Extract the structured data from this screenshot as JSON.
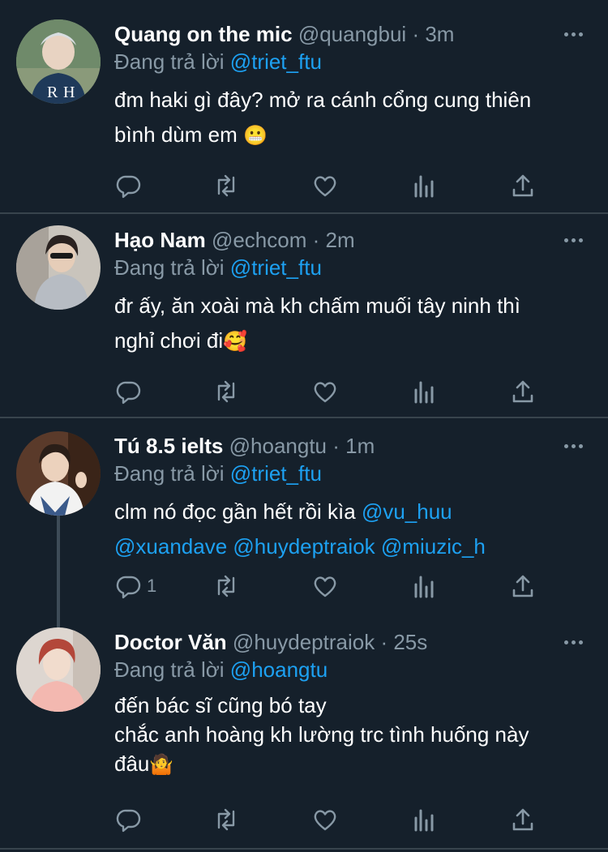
{
  "reply_prefix": "Đang trả lời",
  "colors": {
    "background": "#15202b",
    "text": "#ffffff",
    "muted": "#8899a6",
    "accent": "#1da1f2",
    "divider": "#38444d"
  },
  "icons": [
    "more-icon",
    "reply-icon",
    "retweet-icon",
    "like-icon",
    "analytics-icon",
    "share-icon"
  ],
  "tweets": [
    {
      "name": "Quang on the mic",
      "handle": "@quangbui",
      "separator": "·",
      "time": "3m",
      "reply_to": "@triet_ftu",
      "text_line1": "đm haki gì đây? mở ra cánh cổng cung thiên",
      "text_line2": "bình dùm em",
      "emoji": "😬",
      "reply_count": ""
    },
    {
      "name": "Hạo Nam",
      "handle": "@echcom",
      "separator": "·",
      "time": "2m",
      "reply_to": "@triet_ftu",
      "text_line1": "đr ấy, ăn xoài mà kh chấm muối tây ninh thì",
      "text_line2": "nghỉ chơi đi",
      "emoji": "🥰",
      "reply_count": ""
    },
    {
      "name": "Tú 8.5 ielts",
      "handle": "@hoangtu",
      "separator": "·",
      "time": "1m",
      "reply_to": "@triet_ftu",
      "text_line1": "clm nó đọc gần hết rồi kìa",
      "mentions": [
        "@vu_huu",
        "@xuandave",
        "@huydeptraiok",
        "@miuzic_h"
      ],
      "reply_count": "1"
    },
    {
      "name": "Doctor Văn",
      "handle": "@huydeptraiok",
      "separator": "·",
      "time": "25s",
      "reply_to": "@hoangtu",
      "text_line1": "đến bác sĩ cũng bó tay",
      "text_line2": "chắc anh hoàng kh lường trc tình huống này",
      "text_line3": "đâu",
      "emoji": "🤷",
      "reply_count": ""
    }
  ]
}
